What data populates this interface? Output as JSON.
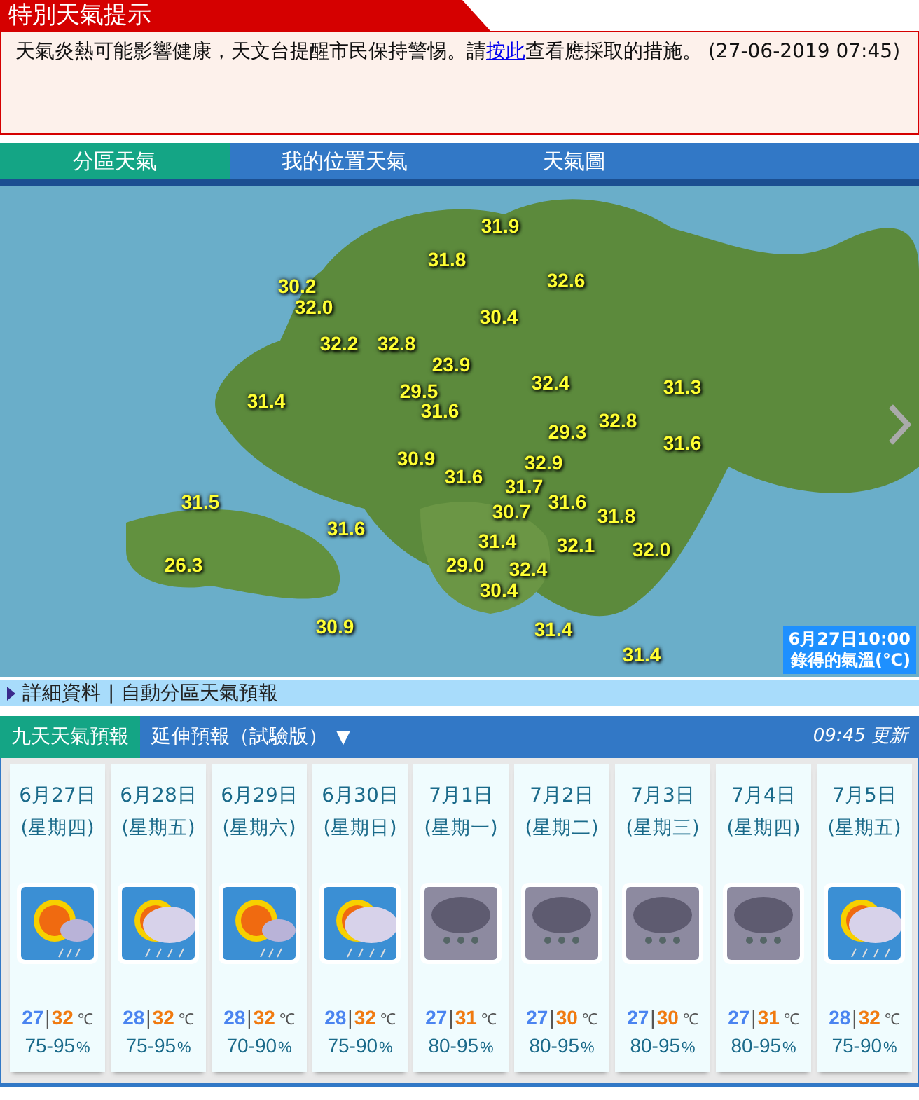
{
  "alert": {
    "title": "特別天氣提示",
    "message_before": "天氣炎熱可能影響健康，天文台提醒市民保持警惕。請",
    "link": "按此",
    "message_after": "查看應採取的措施。 (27-06-2019 07:45)"
  },
  "tabs": [
    {
      "label": "分區天氣",
      "selected": true
    },
    {
      "label": "我的位置天氣",
      "selected": false
    },
    {
      "label": "天氣圖",
      "selected": false
    }
  ],
  "map": {
    "temperatures": [
      "31.9",
      "31.8",
      "30.2",
      "32.6",
      "32.0",
      "30.4",
      "32.2",
      "32.8",
      "23.9",
      "31.4",
      "29.5",
      "32.4",
      "31.3",
      "31.6",
      "29.3",
      "32.8",
      "31.6",
      "30.9",
      "31.6",
      "32.9",
      "31.7",
      "31.5",
      "30.7",
      "31.6",
      "31.8",
      "31.6",
      "31.4",
      "32.1",
      "32.0",
      "26.3",
      "29.0",
      "32.4",
      "30.4",
      "30.9",
      "31.4",
      "31.4"
    ],
    "caption_time": "6月27日10:00",
    "caption_label": "錄得的氣溫(℃)"
  },
  "info_links": [
    {
      "label": "詳細資料"
    },
    {
      "label": "自動分區天氣預報"
    }
  ],
  "info_separator": "|",
  "forecast_tabs": [
    {
      "label": "九天天氣預報",
      "selected": true,
      "dropdown": false
    },
    {
      "label": "延伸預報（試驗版）",
      "selected": false,
      "dropdown": true
    }
  ],
  "dropdown_glyph": "▼",
  "updated": "09:45 更新",
  "temp_unit": "℃",
  "humidity_unit": "%",
  "days": [
    {
      "date": "6月27日",
      "weekday": "(星期四)",
      "kind": "sun-showers",
      "min": "27",
      "max": "32",
      "humidity": "75-95"
    },
    {
      "date": "6月28日",
      "weekday": "(星期五)",
      "kind": "cloud-sun-showers",
      "min": "28",
      "max": "32",
      "humidity": "75-95"
    },
    {
      "date": "6月29日",
      "weekday": "(星期六)",
      "kind": "sun-showers",
      "min": "28",
      "max": "32",
      "humidity": "70-90"
    },
    {
      "date": "6月30日",
      "weekday": "(星期日)",
      "kind": "cloud-sun-showers",
      "min": "28",
      "max": "32",
      "humidity": "75-90"
    },
    {
      "date": "7月1日",
      "weekday": "(星期一)",
      "kind": "rain",
      "min": "27",
      "max": "31",
      "humidity": "80-95"
    },
    {
      "date": "7月2日",
      "weekday": "(星期二)",
      "kind": "rain",
      "min": "27",
      "max": "30",
      "humidity": "80-95"
    },
    {
      "date": "7月3日",
      "weekday": "(星期三)",
      "kind": "rain",
      "min": "27",
      "max": "30",
      "humidity": "80-95"
    },
    {
      "date": "7月4日",
      "weekday": "(星期四)",
      "kind": "rain",
      "min": "27",
      "max": "31",
      "humidity": "80-95"
    },
    {
      "date": "7月5日",
      "weekday": "(星期五)",
      "kind": "cloud-sun-showers",
      "min": "28",
      "max": "32",
      "humidity": "75-90"
    }
  ]
}
